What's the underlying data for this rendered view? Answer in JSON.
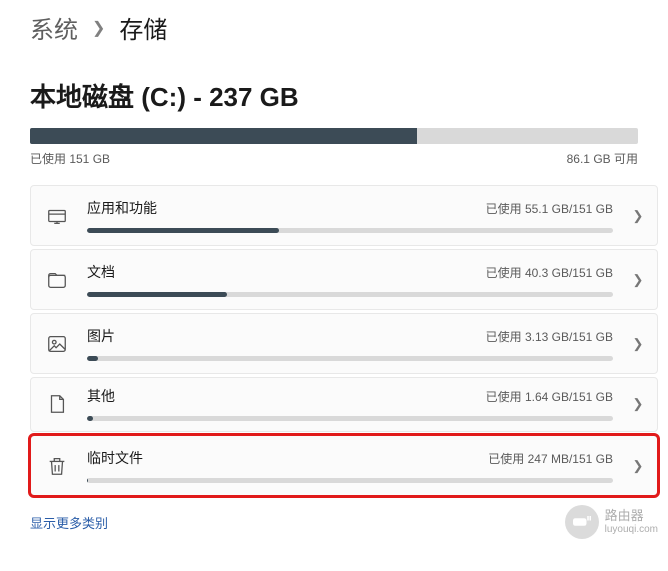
{
  "breadcrumb": {
    "parent": "系统",
    "current": "存储"
  },
  "disk": {
    "title": "本地磁盘 (C:) - 237 GB",
    "used_label": "已使用 151 GB",
    "free_label": "86.1 GB 可用",
    "used_percent": 63.7
  },
  "categories": [
    {
      "id": "apps",
      "icon": "apps-icon",
      "name": "应用和功能",
      "usage_label": "已使用 55.1 GB/151 GB",
      "used_value": 55.1,
      "total_value": 151,
      "percent": 36.5,
      "compact": false,
      "highlight": false
    },
    {
      "id": "documents",
      "icon": "documents-icon",
      "name": "文档",
      "usage_label": "已使用 40.3 GB/151 GB",
      "used_value": 40.3,
      "total_value": 151,
      "percent": 26.7,
      "compact": false,
      "highlight": false
    },
    {
      "id": "pictures",
      "icon": "pictures-icon",
      "name": "图片",
      "usage_label": "已使用 3.13 GB/151 GB",
      "used_value": 3.13,
      "total_value": 151,
      "percent": 2.1,
      "compact": false,
      "highlight": false
    },
    {
      "id": "other",
      "icon": "other-icon",
      "name": "其他",
      "usage_label": "已使用 1.64 GB/151 GB",
      "used_value": 1.64,
      "total_value": 151,
      "percent": 1.1,
      "compact": true,
      "highlight": false
    },
    {
      "id": "temp",
      "icon": "trash-icon",
      "name": "临时文件",
      "usage_label": "已使用 247 MB/151 GB",
      "used_value": 0.247,
      "total_value": 151,
      "percent": 0.2,
      "compact": false,
      "highlight": true
    }
  ],
  "show_more_label": "显示更多类别",
  "watermark": {
    "line1": "路由器",
    "line2": "luyouqi.com"
  }
}
